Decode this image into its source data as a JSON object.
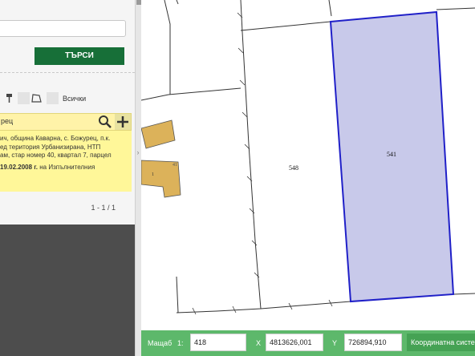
{
  "search": {
    "button_label": "ТЪРСИ"
  },
  "tools": {
    "all_label": "Всички"
  },
  "filter": {
    "value": "рец"
  },
  "result": {
    "line1": "ич, община Каварна, с. Божурец, п.к.",
    "line2": "ед територия Урбанизирана, НТП",
    "line3": "ам, стар номер 40, квартал 7, парцел",
    "line4_bold": "19.02.2008 г.",
    "line4_rest": " на Изпълнителния"
  },
  "pager": {
    "text": "1 - 1 / 1"
  },
  "map": {
    "parcel_labels": [
      "548",
      "541",
      "1",
      "41"
    ],
    "highlight_color": "#c8c9ea",
    "highlight_border": "#2020c8",
    "building_color": "#dcb25a"
  },
  "status": {
    "scale_label": "Мащаб",
    "scale_prefix": "1:",
    "scale_value": "418",
    "x_label": "X",
    "x_value": "4813626,001",
    "y_label": "Y",
    "y_value": "726894,910",
    "crs_label": "Координатна система"
  }
}
